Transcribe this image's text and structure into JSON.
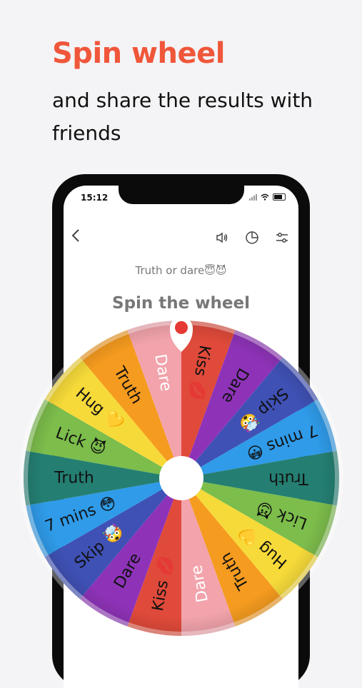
{
  "promo": {
    "headline": "Spin wheel",
    "subline": "and share the results with friends"
  },
  "status_bar": {
    "time": "15:12"
  },
  "toolbar": {
    "back_icon": "chevron-left-icon",
    "icons": [
      "volume-icon",
      "pie-chart-icon",
      "settings-sliders-icon"
    ]
  },
  "wheel": {
    "name": "Truth or dare😇😈",
    "title": "Spin the wheel",
    "pointer_color": "#e53935",
    "center_color": "#ffffff",
    "segments": [
      {
        "label": "Kiss",
        "emoji": "💋",
        "color": "#e04a3a"
      },
      {
        "label": "Dare",
        "emoji": "",
        "color": "#8e33b8"
      },
      {
        "label": "Skip",
        "emoji": "🤯",
        "color": "#3f51b5"
      },
      {
        "label": "7 mins",
        "emoji": "😳",
        "color": "#2f9be9"
      },
      {
        "label": "Truth",
        "emoji": "",
        "color": "#247f72"
      },
      {
        "label": "Lick",
        "emoji": "😈",
        "color": "#7cbd4b"
      },
      {
        "label": "Hug",
        "emoji": "💛",
        "color": "#f6da3a"
      },
      {
        "label": "Truth",
        "emoji": "",
        "color": "#f59b1f"
      },
      {
        "label": "Dare",
        "emoji": "",
        "color": "#f2a3ab"
      },
      {
        "label": "Kiss",
        "emoji": "💋",
        "color": "#e04a3a"
      },
      {
        "label": "Dare",
        "emoji": "",
        "color": "#8e33b8"
      },
      {
        "label": "Skip",
        "emoji": "🤯",
        "color": "#3f51b5"
      },
      {
        "label": "7 mins",
        "emoji": "😳",
        "color": "#2f9be9"
      },
      {
        "label": "Truth",
        "emoji": "",
        "color": "#247f72"
      },
      {
        "label": "Lick",
        "emoji": "😈",
        "color": "#7cbd4b"
      },
      {
        "label": "Hug",
        "emoji": "💛",
        "color": "#f6da3a"
      },
      {
        "label": "Truth",
        "emoji": "",
        "color": "#f59b1f"
      },
      {
        "label": "Dare",
        "emoji": "",
        "color": "#f2a3ab"
      }
    ]
  }
}
